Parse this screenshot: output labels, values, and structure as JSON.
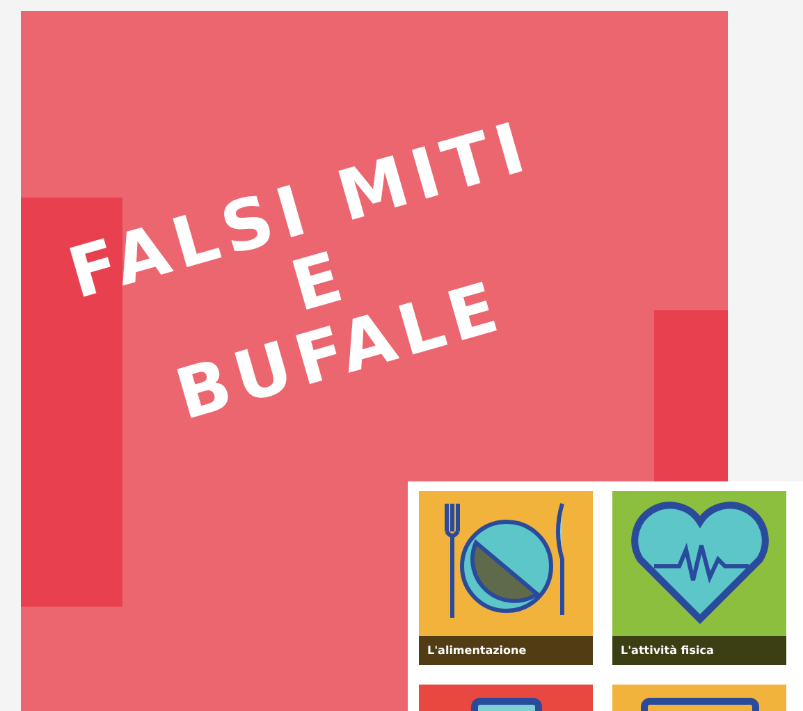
{
  "banner": {
    "lines": [
      "FALSI MITI",
      "E",
      "BUFALE"
    ]
  },
  "tiles": [
    {
      "caption": "L'alimentazione",
      "color": "#f2b33d",
      "kind": "plate"
    },
    {
      "caption": "L'attività fisica",
      "color": "#8dbf3e",
      "kind": "heart"
    },
    {
      "color": "#e8483f",
      "kind": "stack"
    },
    {
      "color": "#f2b33d",
      "kind": "screen"
    }
  ]
}
